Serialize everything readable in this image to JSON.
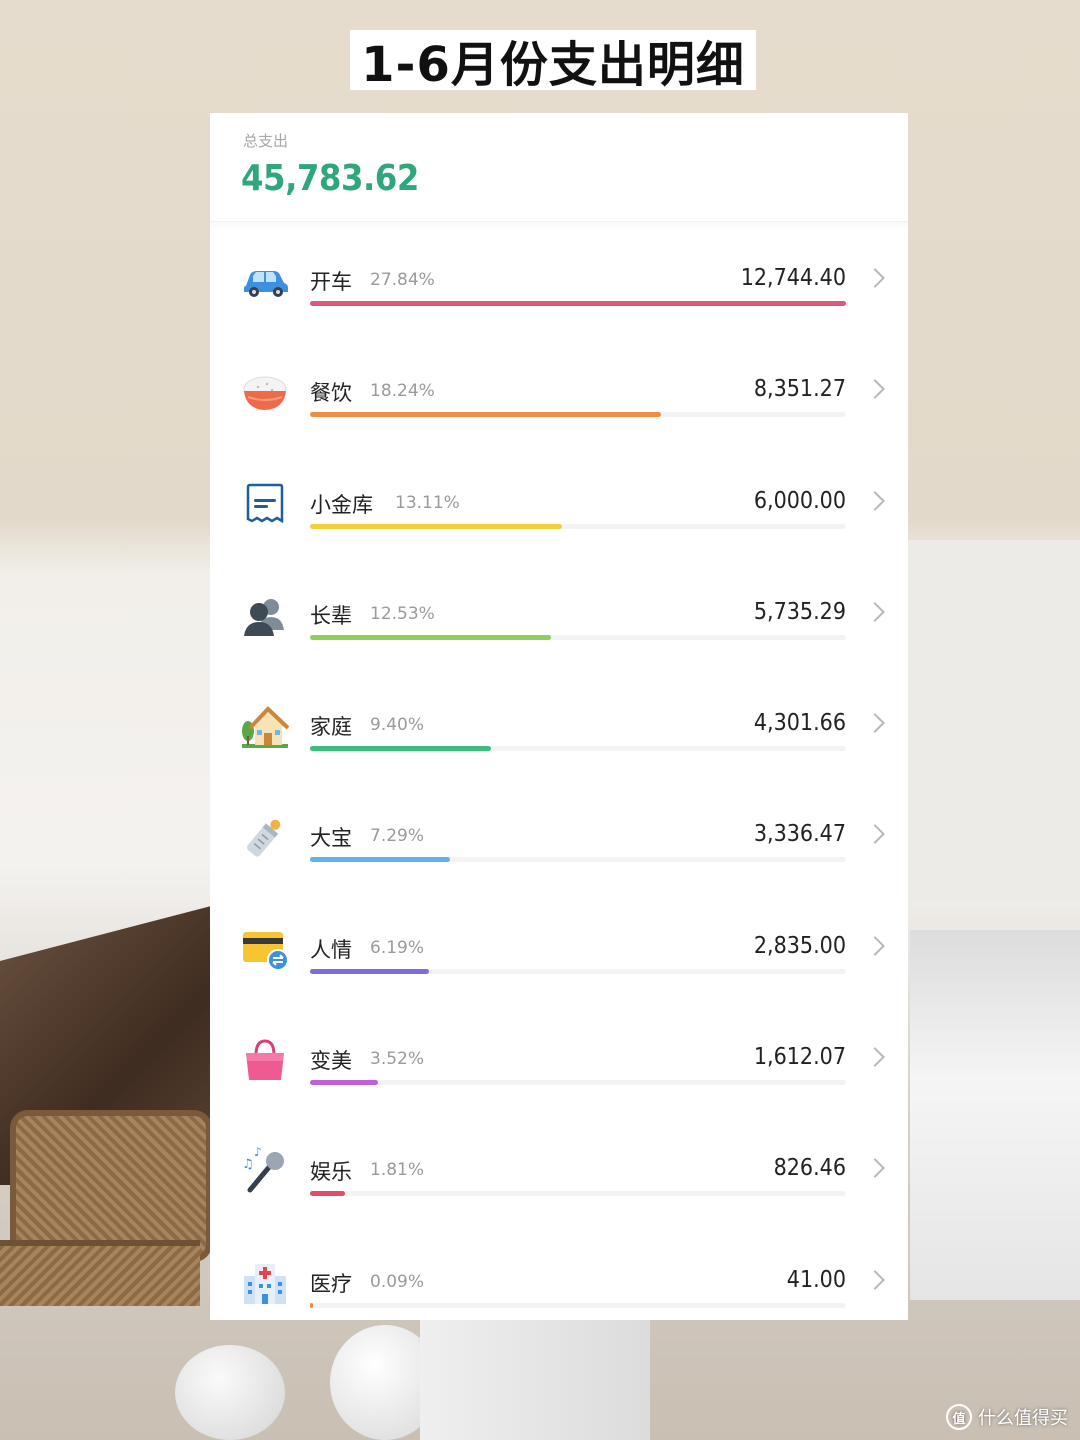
{
  "page_title": "1-6月份支出明细",
  "summary": {
    "label": "总支出",
    "amount": "45,783.62",
    "accent": "#2fa77a"
  },
  "categories": [
    {
      "name": "开车",
      "percent": "27.84%",
      "amount": "12,744.40",
      "share": 0.2784,
      "color": "#e2557a",
      "icon": "car-icon"
    },
    {
      "name": "餐饮",
      "percent": "18.24%",
      "amount": "8,351.27",
      "share": 0.1824,
      "color": "#ef8f46",
      "icon": "rice-bowl-icon"
    },
    {
      "name": "小金库",
      "percent": "13.11%",
      "amount": "6,000.00",
      "share": 0.1311,
      "color": "#f2cf3a",
      "icon": "receipt-icon"
    },
    {
      "name": "长辈",
      "percent": "12.53%",
      "amount": "5,735.29",
      "share": 0.1253,
      "color": "#8ccf5a",
      "icon": "people-icon"
    },
    {
      "name": "家庭",
      "percent": "9.40%",
      "amount": "4,301.66",
      "share": 0.094,
      "color": "#3dbd7d",
      "icon": "house-icon"
    },
    {
      "name": "大宝",
      "percent": "7.29%",
      "amount": "3,336.47",
      "share": 0.0729,
      "color": "#5fb1e6",
      "icon": "baby-bottle-icon"
    },
    {
      "name": "人情",
      "percent": "6.19%",
      "amount": "2,835.00",
      "share": 0.0619,
      "color": "#7d6be0",
      "icon": "card-transfer-icon"
    },
    {
      "name": "变美",
      "percent": "3.52%",
      "amount": "1,612.07",
      "share": 0.0352,
      "color": "#c15fd6",
      "icon": "handbag-icon"
    },
    {
      "name": "娱乐",
      "percent": "1.81%",
      "amount": "826.46",
      "share": 0.0181,
      "color": "#e34b6b",
      "icon": "microphone-icon"
    },
    {
      "name": "医疗",
      "percent": "0.09%",
      "amount": "41.00",
      "share": 0.0009,
      "color": "#f08a3a",
      "icon": "hospital-icon"
    }
  ],
  "watermark": {
    "text": "什么值得买",
    "icon": "值"
  }
}
